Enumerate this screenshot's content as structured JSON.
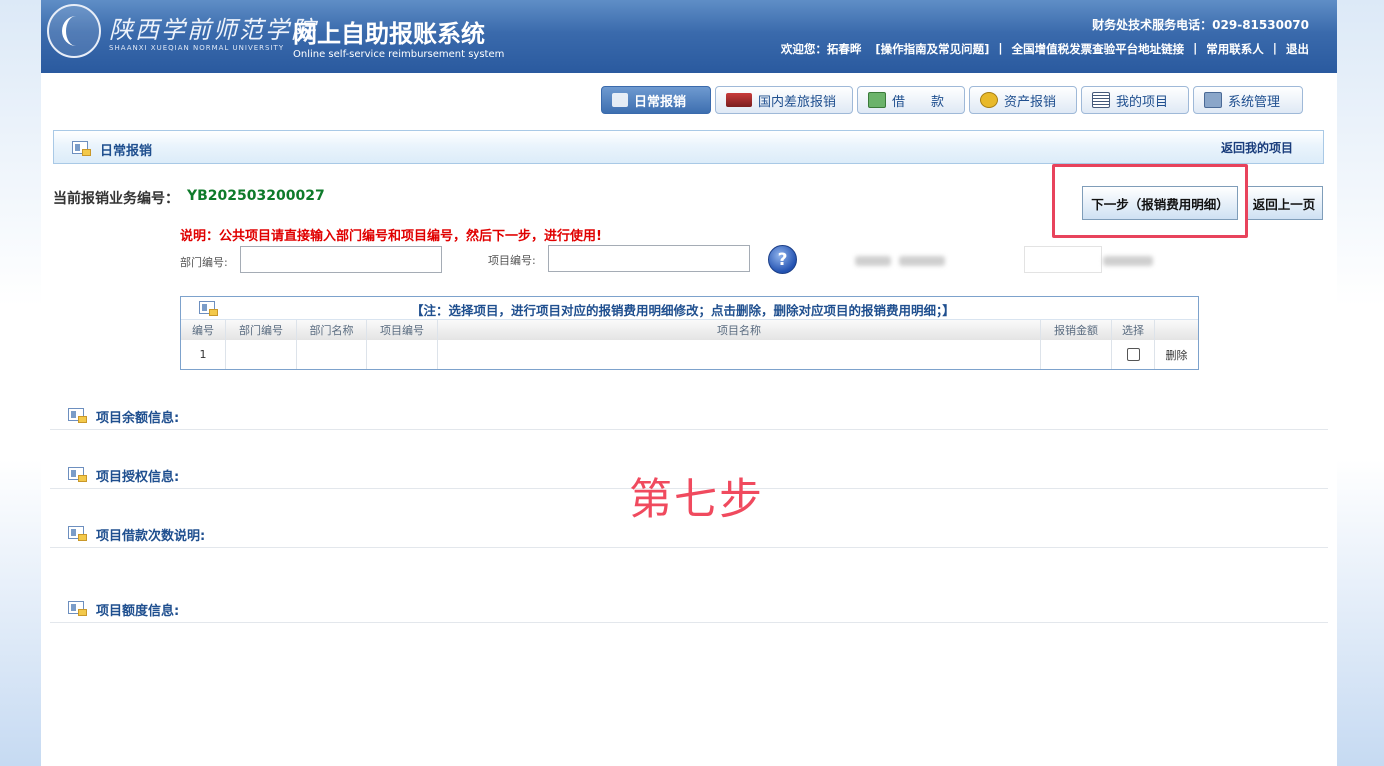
{
  "header": {
    "school_cn": "陕西学前师范学院",
    "school_en": "SHAANXI XUEQIAN NORMAL UNIVERSITY",
    "title": "网上自助报账系统",
    "subtitle": "Online self-service reimbursement system",
    "hotline": "财务处技术服务电话：029-81530070",
    "welcome": "欢迎您：",
    "user": "拓春晔",
    "guide": "[操作指南及常见问题]",
    "invoice_link": "全国增值税发票查验平台地址链接",
    "contacts": "常用联系人",
    "logout": "退出",
    "separator": "|"
  },
  "nav": {
    "tabs": [
      {
        "label": "日常报销",
        "icon": "notebook-icon"
      },
      {
        "label": "国内差旅报销",
        "icon": "train-icon"
      },
      {
        "label": "借　　款",
        "icon": "money-icon"
      },
      {
        "label": "资产报销",
        "icon": "coins-icon"
      },
      {
        "label": "我的项目",
        "icon": "list-icon"
      },
      {
        "label": "系统管理",
        "icon": "computer-icon"
      }
    ]
  },
  "section": {
    "title": "日常报销",
    "back_link": "返回我的项目"
  },
  "business": {
    "label": "当前报销业务编号：",
    "number": "YB202503200027",
    "next_button": "下一步（报销费用明细）",
    "back_button": "返回上一页"
  },
  "form": {
    "note": "说明：公共项目请直接输入部门编号和项目编号，然后下一步，进行使用!",
    "dept_label": "部门编号:",
    "dept_value": "",
    "project_label": "项目编号:",
    "project_value": "",
    "help_icon": "?"
  },
  "table": {
    "note": "【注：选择项目，进行项目对应的报销费用明细修改；点击删除，删除对应项目的报销费用明细；】",
    "headers": [
      "编号",
      "部门编号",
      "部门名称",
      "项目编号",
      "项目名称",
      "报销金额",
      "选择",
      ""
    ],
    "rows": [
      {
        "no": "1",
        "dept_no": "",
        "dept_name": "",
        "proj_no": "",
        "proj_name": "",
        "amount": "",
        "delete": "删除"
      }
    ]
  },
  "info_sections": [
    {
      "title": "项目余额信息:"
    },
    {
      "title": "项目授权信息:"
    },
    {
      "title": "项目借款次数说明:"
    },
    {
      "title": "项目额度信息:"
    }
  ],
  "annotation": "第七步",
  "colors": {
    "header_blue": "#3a6aac",
    "biz_number_green": "#0e7a2a",
    "note_red": "#e00000",
    "annotation_red": "#f04a5e"
  }
}
